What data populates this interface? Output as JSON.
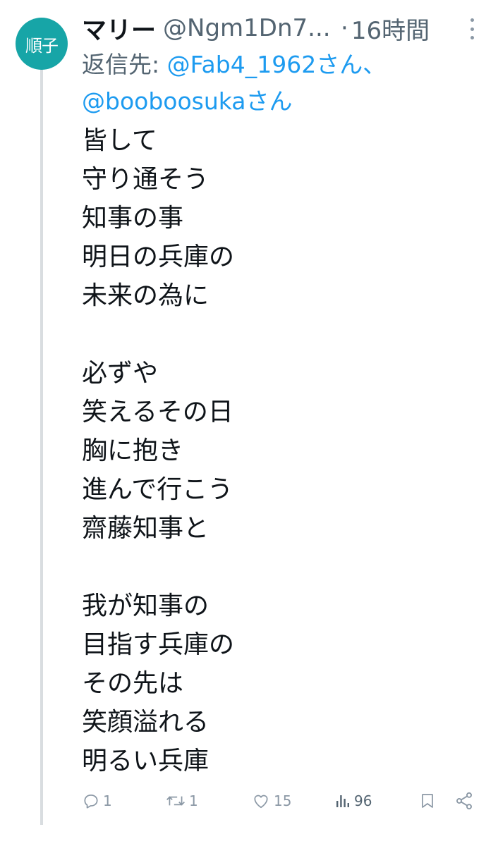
{
  "author": {
    "avatar_text": "順子",
    "name": "マリー",
    "handle": "@Ngm1Dn7...",
    "separator": "·",
    "time": "16時間"
  },
  "reply": {
    "prefix": "返信先: ",
    "mention_1": "@Fab4_1962さん、",
    "mention_2": "@booboosukaさん"
  },
  "body_lines": [
    "皆して",
    "守り通そう",
    "知事の事",
    "明日の兵庫の",
    "未来の為に",
    "",
    "必ずや",
    "笑えるその日",
    "胸に抱き",
    "進んで行こう",
    "齋藤知事と",
    "",
    "我が知事の",
    "目指す兵庫の",
    "その先は",
    "笑顔溢れる",
    "明るい兵庫"
  ],
  "actions": {
    "replies": "1",
    "retweets": "1",
    "likes": "15",
    "views": "96"
  },
  "icons": {
    "more": "more-vertical-icon",
    "reply": "reply-icon",
    "retweet": "retweet-icon",
    "like": "heart-icon",
    "views": "views-chart-icon",
    "bookmark": "bookmark-icon",
    "share": "share-icon"
  },
  "colors": {
    "avatar_bg": "#17a5a7",
    "mention": "#1d9bf0",
    "muted": "#536471",
    "thread_line": "#d9dde0"
  }
}
